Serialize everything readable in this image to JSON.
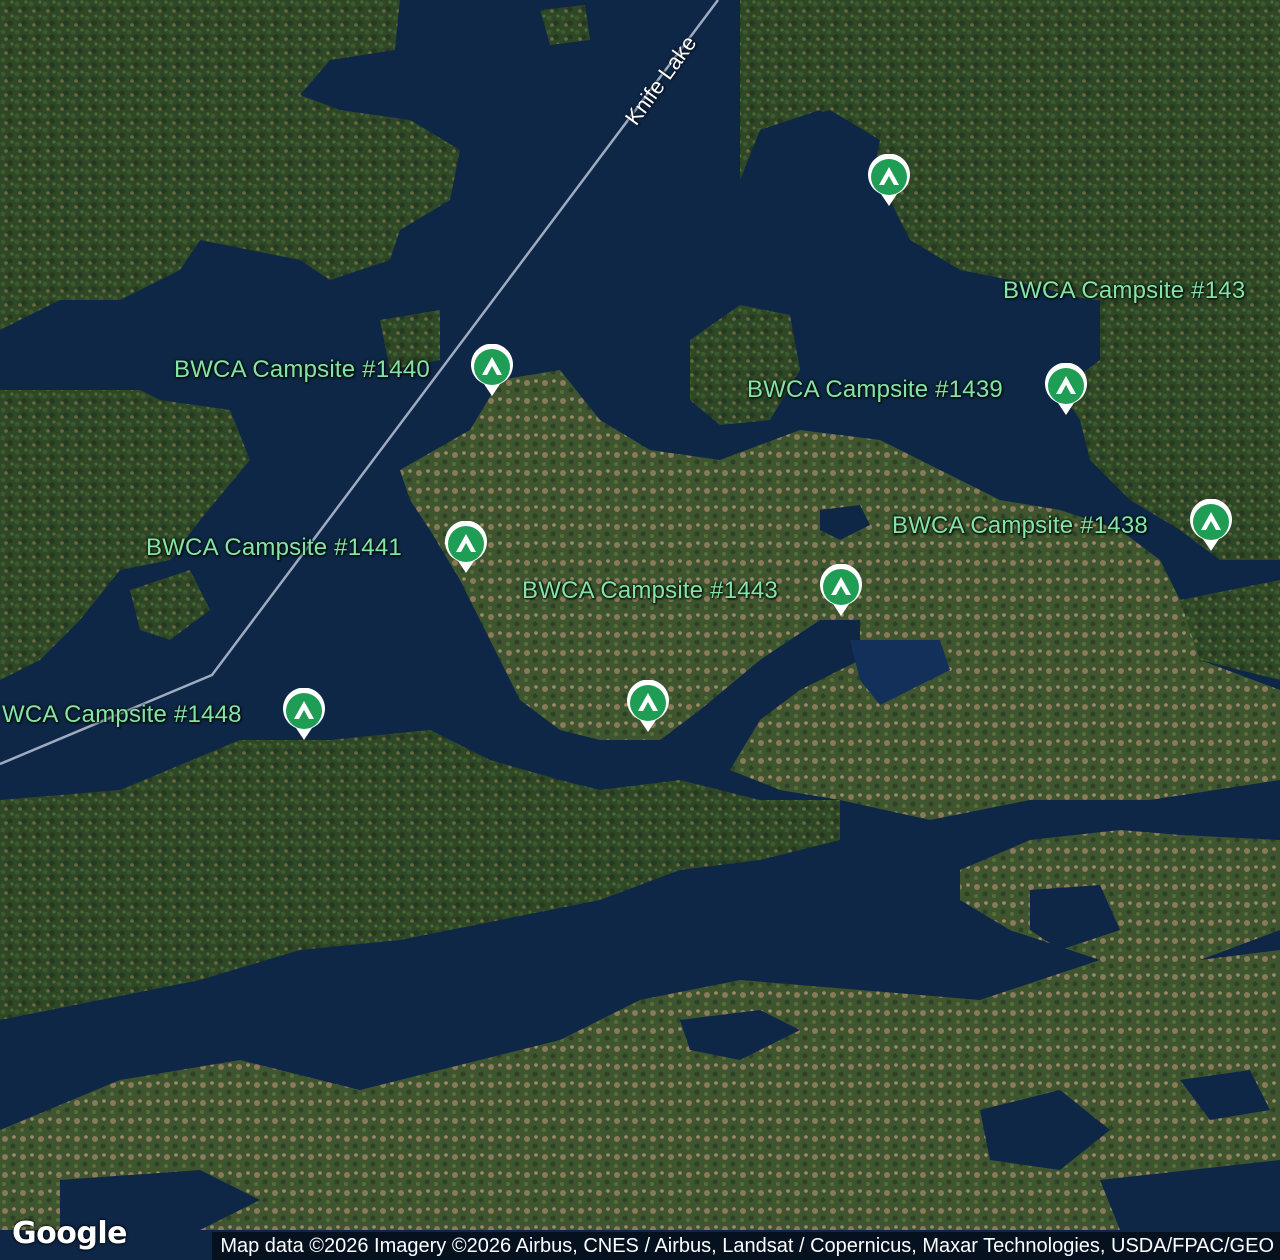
{
  "map": {
    "lake_label": "Knife Lake",
    "colors": {
      "water": "#0f2747",
      "forest": "#2f4a27",
      "pin": "#1f9d55",
      "label": "#86e3a8"
    }
  },
  "campsites": [
    {
      "label": "",
      "icon": "campground-icon"
    },
    {
      "label": "BWCA Campsite #143",
      "icon": ""
    },
    {
      "label": "BWCA Campsite #1440",
      "icon": "campground-icon"
    },
    {
      "label": "BWCA Campsite #1439",
      "icon": "campground-icon"
    },
    {
      "label": "BWCA Campsite #1438",
      "icon": "campground-icon"
    },
    {
      "label": "BWCA Campsite #1441",
      "icon": "campground-icon"
    },
    {
      "label": "BWCA Campsite #1443",
      "icon": "campground-icon"
    },
    {
      "label": "",
      "icon": "campground-icon"
    },
    {
      "label": "WCA Campsite #1448",
      "icon": "campground-icon"
    }
  ],
  "footer": {
    "logo": "Google",
    "attribution": "Map data ©2026 Imagery ©2026 Airbus, CNES / Airbus, Landsat / Copernicus, Maxar Technologies, USDA/FPAC/GEO"
  }
}
